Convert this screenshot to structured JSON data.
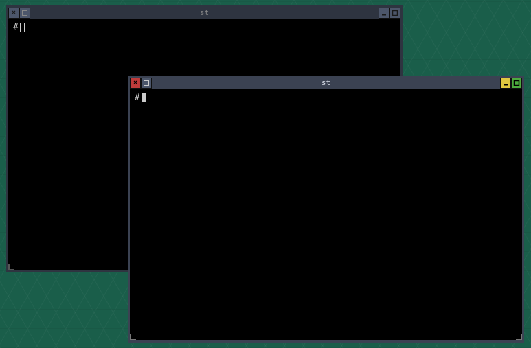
{
  "windows": {
    "back": {
      "title": "st",
      "prompt": "#",
      "active": false
    },
    "front": {
      "title": "st",
      "prompt": "#",
      "active": true
    }
  },
  "buttons": {
    "close_glyph": "×",
    "min_glyph": "_"
  }
}
